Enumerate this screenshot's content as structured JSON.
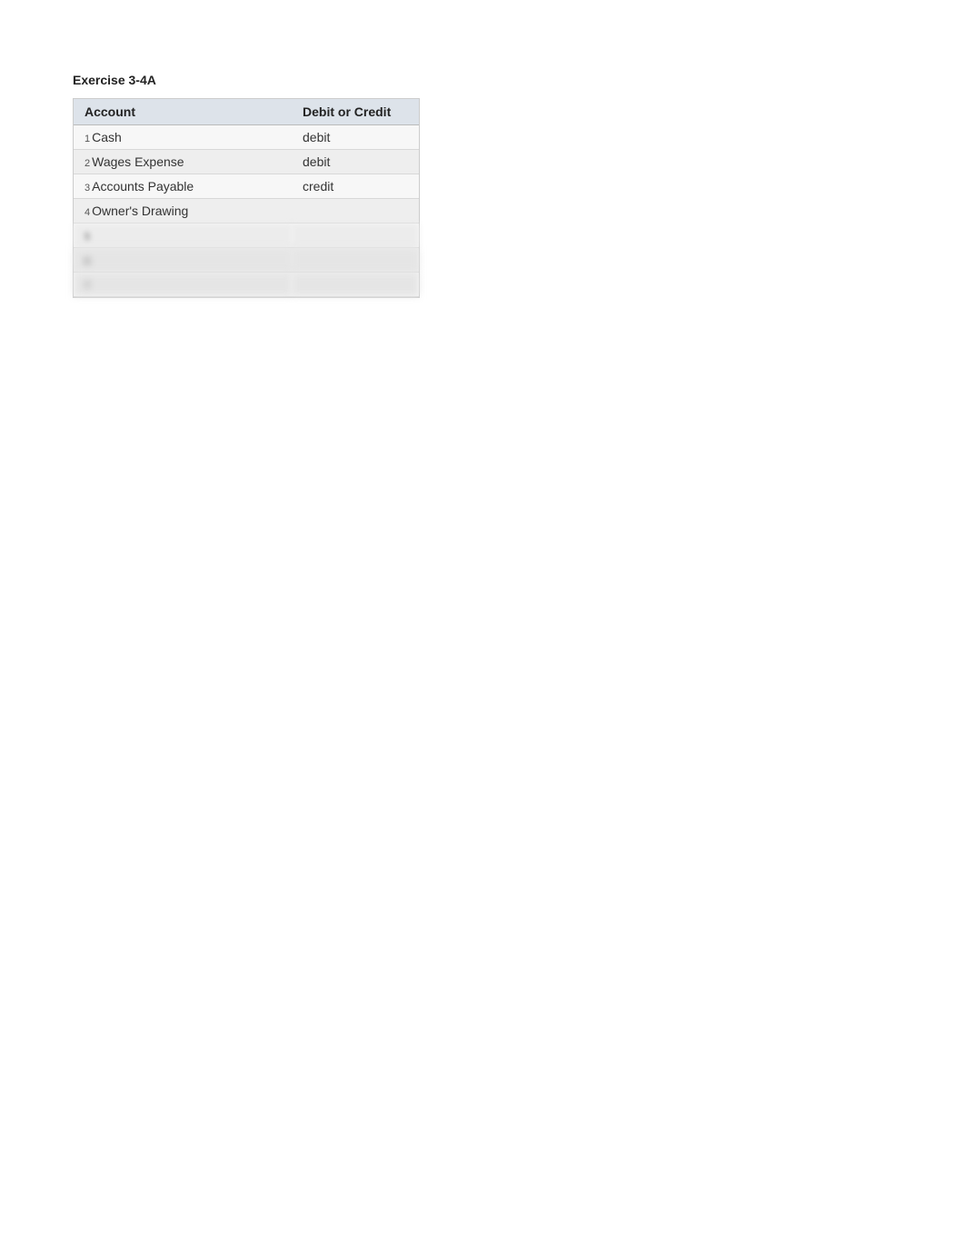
{
  "exercise": {
    "title": "Exercise 3-4A"
  },
  "table": {
    "headers": {
      "account": "Account",
      "debit_or_credit": "Debit or Credit"
    },
    "rows": [
      {
        "number": "1",
        "account": "Cash",
        "value": "debit"
      },
      {
        "number": "2",
        "account": "Wages Expense",
        "value": "debit"
      },
      {
        "number": "3",
        "account": "Accounts Payable",
        "value": "credit"
      },
      {
        "number": "4",
        "account": "Owner's Drawing",
        "value": ""
      },
      {
        "number": "5",
        "account": "",
        "value": ""
      },
      {
        "number": "6",
        "account": "",
        "value": ""
      },
      {
        "number": "7",
        "account": "",
        "value": ""
      }
    ]
  }
}
